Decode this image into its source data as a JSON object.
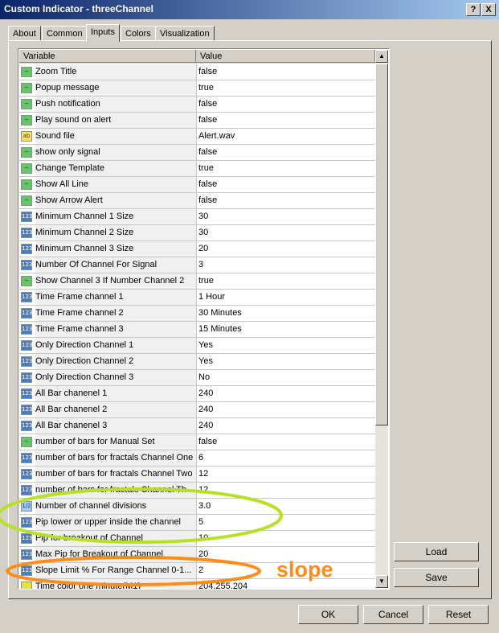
{
  "window": {
    "title": "Custom Indicator - threeChannel",
    "help_label": "?",
    "close_label": "X"
  },
  "tabs": [
    {
      "label": "About"
    },
    {
      "label": "Common"
    },
    {
      "label": "Inputs"
    },
    {
      "label": "Colors"
    },
    {
      "label": "Visualization"
    }
  ],
  "grid": {
    "col_variable": "Variable",
    "col_value": "Value",
    "rows": [
      {
        "icon": "bool",
        "name": "Zoom Title",
        "value": "false"
      },
      {
        "icon": "bool",
        "name": "Popup message",
        "value": "true"
      },
      {
        "icon": "bool",
        "name": "Push notification",
        "value": "false"
      },
      {
        "icon": "bool",
        "name": "Play sound on alert",
        "value": "false"
      },
      {
        "icon": "str",
        "name": "Sound file",
        "value": "Alert.wav"
      },
      {
        "icon": "bool",
        "name": "show only signal",
        "value": "false"
      },
      {
        "icon": "bool",
        "name": "Change Template",
        "value": "true"
      },
      {
        "icon": "bool",
        "name": "Show All Line",
        "value": "false"
      },
      {
        "icon": "bool",
        "name": "Show Arrow  Alert",
        "value": "false"
      },
      {
        "icon": "int",
        "name": "Minimum Channel 1 Size",
        "value": "30"
      },
      {
        "icon": "int",
        "name": "Minimum Channel 2 Size",
        "value": "30"
      },
      {
        "icon": "int",
        "name": "Minimum Channel 3 Size",
        "value": "20"
      },
      {
        "icon": "int",
        "name": "Number Of Channel For Signal",
        "value": "3"
      },
      {
        "icon": "bool",
        "name": "Show Channel 3 If Number Channel 2",
        "value": "true"
      },
      {
        "icon": "int",
        "name": "Time Frame channel 1",
        "value": "1 Hour"
      },
      {
        "icon": "int",
        "name": "Time Frame channel 2",
        "value": "30 Minutes"
      },
      {
        "icon": "int",
        "name": "Time Frame channel 3",
        "value": "15 Minutes"
      },
      {
        "icon": "int",
        "name": "Only Direction Channel 1",
        "value": "Yes"
      },
      {
        "icon": "int",
        "name": "Only Direction Channel 2",
        "value": "Yes"
      },
      {
        "icon": "int",
        "name": "Only Direction Channel 3",
        "value": "No"
      },
      {
        "icon": "int",
        "name": "All Bar  chanenel 1",
        "value": "240"
      },
      {
        "icon": "int",
        "name": "All Bar  chanenel 2",
        "value": "240"
      },
      {
        "icon": "int",
        "name": "All Bar  chanenel 3",
        "value": "240"
      },
      {
        "icon": "bool",
        "name": "number of bars for Manual Set",
        "value": "false"
      },
      {
        "icon": "int",
        "name": "number of bars for fractals Channel One",
        "value": "6"
      },
      {
        "icon": "int",
        "name": "number of bars for fractals Channel Two",
        "value": "12"
      },
      {
        "icon": "int",
        "name": "number of bars for fractals  Channel Th...",
        "value": "12"
      },
      {
        "icon": "dbl",
        "name": "Number of channel divisions",
        "value": "3.0"
      },
      {
        "icon": "int",
        "name": "Pip lower or upper inside the channel",
        "value": "5"
      },
      {
        "icon": "int",
        "name": "Pip for breakout of Channel",
        "value": "10"
      },
      {
        "icon": "int",
        "name": "Max Pip for Breakout of Channel",
        "value": "20"
      },
      {
        "icon": "int",
        "name": "Slope Limit  % For Range Channel 0-1...",
        "value": "2"
      },
      {
        "icon": "col",
        "name": "Time color one minute(M1)",
        "value": "204,255,204"
      }
    ]
  },
  "buttons": {
    "load": "Load",
    "save": "Save",
    "ok": "OK",
    "cancel": "Cancel",
    "reset": "Reset"
  },
  "annotation": {
    "text": "slope",
    "color": "#ff8c1a",
    "green_ring_color": "#b8e024"
  },
  "colors": {
    "titlebar_start": "#0a246a",
    "titlebar_end": "#a6caf0",
    "dialog_face": "#d4d0c8"
  }
}
